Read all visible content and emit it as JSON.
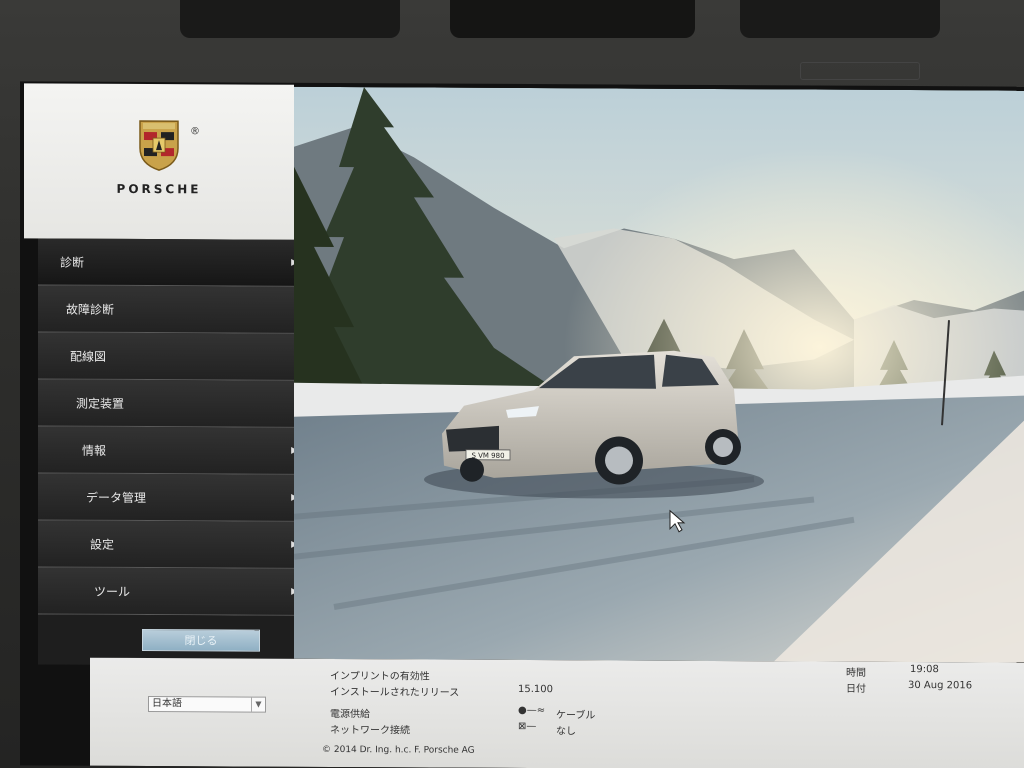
{
  "brand": {
    "logo_text": "PORSCHE",
    "registered": "®"
  },
  "menu": {
    "items": [
      {
        "label": "診断",
        "has_submenu": true
      },
      {
        "label": "故障診断",
        "has_submenu": false
      },
      {
        "label": "配線図",
        "has_submenu": false
      },
      {
        "label": "測定装置",
        "has_submenu": false
      },
      {
        "label": "情報",
        "has_submenu": true
      },
      {
        "label": "データ管理",
        "has_submenu": true
      },
      {
        "label": "設定",
        "has_submenu": true
      },
      {
        "label": "ツール",
        "has_submenu": true
      }
    ],
    "close_label": "閉じる"
  },
  "hero": {
    "plate_text": "S VM 980"
  },
  "status": {
    "language": "日本語",
    "imprint_validity_label": "インプリントの有効性",
    "installed_release_label": "インストールされたリリース",
    "installed_release_value": "15.100",
    "power_supply_label": "電源供給",
    "power_supply_value": "ケーブル",
    "network_label": "ネットワーク接続",
    "network_value": "なし",
    "copyright": "© 2014 Dr. Ing. h.c. F. Porsche AG",
    "time_label": "時間",
    "time_value": "19:08",
    "date_label": "日付",
    "date_value": "30 Aug 2016"
  },
  "icons": {
    "power": "plug-icon",
    "network": "network-disconnected-icon",
    "chevron": "chevron-right-icon",
    "cursor": "mouse-cursor-icon"
  },
  "colors": {
    "sidebar_bg": "#222222",
    "button_blue": "#9fbccd",
    "info_bg": "#e4e4e2"
  }
}
